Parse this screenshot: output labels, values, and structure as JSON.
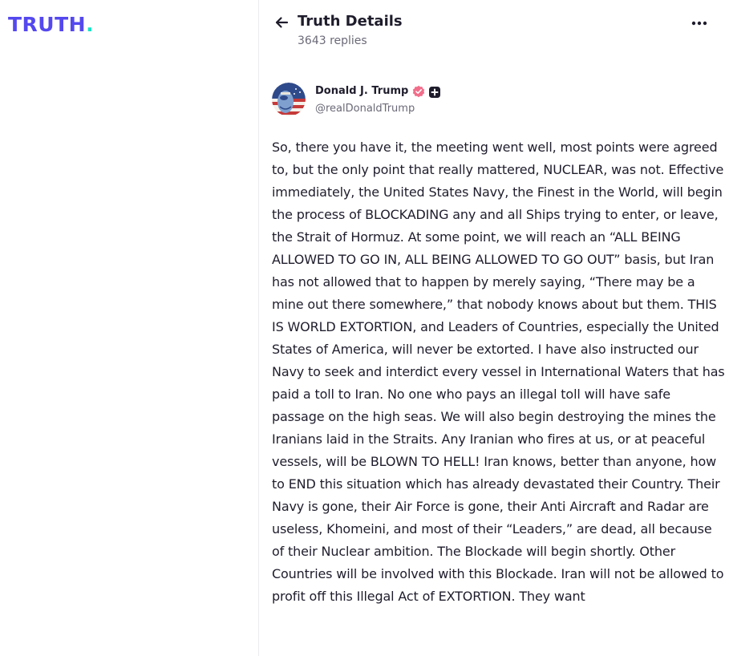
{
  "brand": {
    "logo_text": "TRUTH",
    "logo_dot": ".",
    "primary_color": "#5448ee",
    "accent_color": "#17e3c9"
  },
  "header": {
    "back_icon": "arrow-left-icon",
    "title": "Truth Details",
    "subtitle": "3643 replies",
    "more_icon": "ellipsis-icon"
  },
  "post": {
    "author": {
      "name": "Donald J. Trump",
      "handle": "@realDonaldTrump",
      "verified_icon": "verified-badge-icon",
      "plus_icon": "plus-badge-icon",
      "verified_color": "#f26d8a"
    },
    "body": "So, there you have it, the meeting went well, most points were agreed to, but the only point that really mattered, NUCLEAR, was not. Effective immediately, the United States Navy, the Finest in the World, will begin the process of BLOCKADING any and all Ships trying to enter, or leave, the Strait of Hormuz. At some point, we will reach an “ALL BEING ALLOWED TO GO IN, ALL BEING ALLOWED TO GO OUT” basis, but Iran has not allowed that to happen by merely saying, “There may be a mine out there somewhere,” that nobody knows about but them. THIS IS WORLD EXTORTION, and Leaders of Countries, especially the United States of America, will never be extorted. I have also instructed our Navy to seek and interdict every vessel in International Waters that has paid a toll to Iran. No one who pays an illegal toll will have safe passage on the high seas. We will also begin destroying the mines the Iranians laid in the Straits. Any Iranian who fires at us, or at peaceful vessels, will be BLOWN TO HELL! Iran knows, better than anyone, how to END this situation which has already devastated their Country. Their Navy is gone, their Air Force is gone, their Anti Aircraft and Radar are useless, Khomeini, and most of their “Leaders,” are dead, all because of their Nuclear ambition. The Blockade will begin shortly. Other Countries will be involved with this Blockade. Iran will not be allowed to profit off this Illegal Act of EXTORTION. They want"
  }
}
